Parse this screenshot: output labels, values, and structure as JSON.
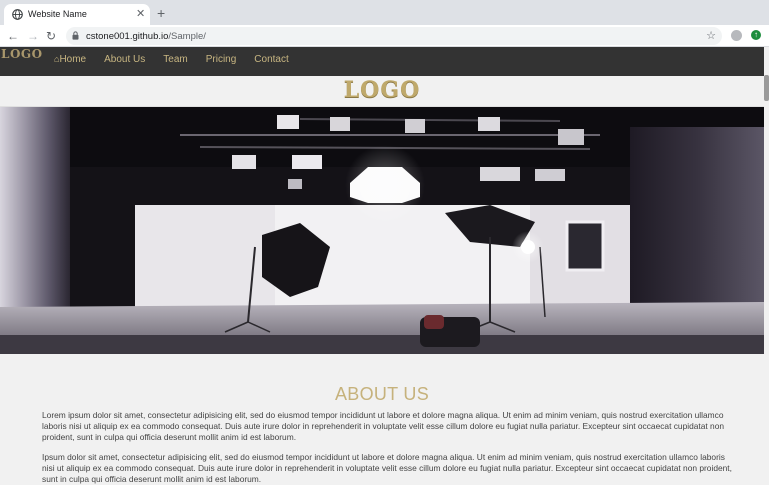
{
  "browser": {
    "tab_title": "Website Name",
    "new_tab_glyph": "+",
    "close_glyph": "✕",
    "url_host": "cstone001.github.io",
    "url_path": "/Sample/"
  },
  "site": {
    "nav_brand": "LOGO",
    "nav_links": [
      "Home",
      "About Us",
      "Team",
      "Pricing",
      "Contact"
    ],
    "banner_logo": "LOGO",
    "accent_color": "#c6b27c",
    "navbar_color": "#333333"
  },
  "hero": {
    "image_description_icon": "photo-studio-image"
  },
  "about": {
    "heading": "ABOUT US",
    "paragraph_1": "Lorem ipsum dolor sit amet, consectetur adipisicing elit, sed do eiusmod tempor incididunt ut labore et dolore magna aliqua. Ut enim ad minim veniam, quis nostrud exercitation ullamco laboris nisi ut aliquip ex ea commodo consequat. Duis aute irure dolor in reprehenderit in voluptate velit esse cillum dolore eu fugiat nulla pariatur. Excepteur sint occaecat cupidatat non proident, sunt in culpa qui officia deserunt mollit anim id est laborum.",
    "paragraph_2": "Ipsum dolor sit amet, consectetur adipisicing elit, sed do eiusmod tempor incididunt ut labore et dolore magna aliqua. Ut enim ad minim veniam, quis nostrud exercitation ullamco laboris nisi ut aliquip ex ea commodo consequat. Duis aute irure dolor in reprehenderit in voluptate velit esse cillum dolore eu fugiat nulla pariatur. Excepteur sint occaecat cupidatat non proident, sunt in culpa qui officia deserunt mollit anim id est laborum."
  }
}
